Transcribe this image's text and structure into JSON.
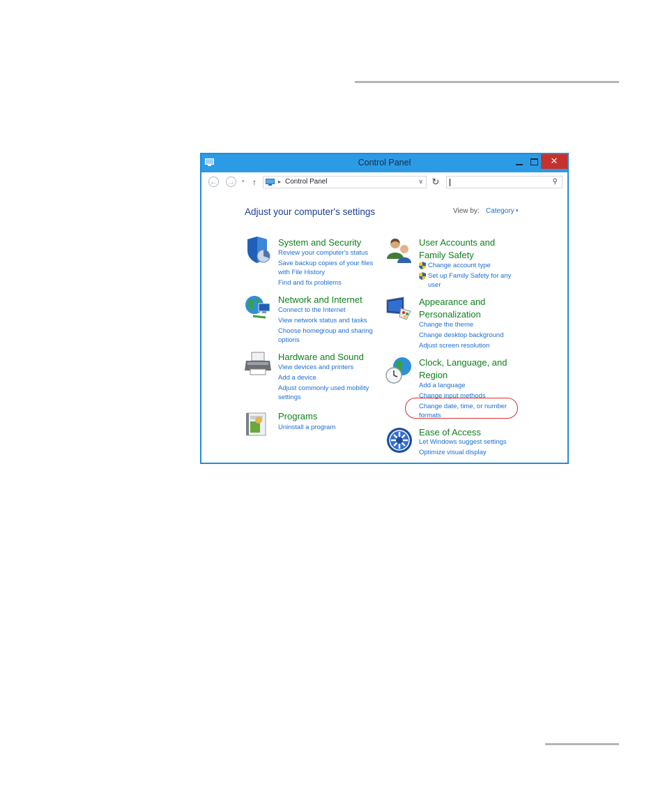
{
  "window": {
    "title": "Control Panel",
    "close_glyph": "✕"
  },
  "addressbar": {
    "back_glyph": "←",
    "forward_glyph": "→",
    "dropdown_glyph": "▾",
    "up_glyph": "↑",
    "path_separator": "▸",
    "path_label": "Control Panel",
    "path_dropdown_glyph": "∨",
    "refresh_glyph": "↻",
    "search_placeholder": "",
    "search_glyph": "⚲"
  },
  "content": {
    "heading": "Adjust your computer's settings",
    "view_by_label": "View by:",
    "view_by_value": "Category",
    "view_by_arrow": "▾"
  },
  "categories_left": [
    {
      "title": "System and Security",
      "icon": "shield-icon",
      "links": [
        "Review your computer's status",
        "Save backup copies of your files",
        "with File History",
        "Find and fix problems"
      ]
    },
    {
      "title": "Network and Internet",
      "icon": "globe-network-icon",
      "links": [
        "Connect to the Internet",
        "View network status and tasks",
        "Choose homegroup and sharing",
        "options"
      ]
    },
    {
      "title": "Hardware and Sound",
      "icon": "printer-icon",
      "links": [
        "View devices and printers",
        "Add a device",
        "Adjust commonly used mobility",
        "settings"
      ]
    },
    {
      "title": "Programs",
      "icon": "programs-icon",
      "links": [
        "Uninstall a program"
      ]
    }
  ],
  "categories_right": [
    {
      "title_line1": "User Accounts and",
      "title_line2": "Family Safety",
      "icon": "users-icon",
      "links": [
        "Change account type",
        "Set up Family Safety for any",
        "user"
      ]
    },
    {
      "title_line1": "Appearance and",
      "title_line2": "Personalization",
      "icon": "monitor-palette-icon",
      "links": [
        "Change the theme",
        "Change desktop background",
        "Adjust screen resolution"
      ]
    },
    {
      "title_line1": "Clock, Language, and",
      "title_line2": "Region",
      "icon": "clock-globe-icon",
      "links": [
        "Add a language",
        "Change input methods",
        "Change date, time, or number",
        "formats"
      ]
    },
    {
      "title": "Ease of Access",
      "icon": "ease-of-access-icon",
      "links": [
        "Let Windows suggest settings",
        "Optimize visual display"
      ]
    }
  ],
  "colors": {
    "titlebar": "#2b9be6",
    "link": "#1c6ed3",
    "category_title": "#10801e",
    "heading": "#1a3e96",
    "highlight": "#d62f2f",
    "close_button": "#c7302b"
  }
}
